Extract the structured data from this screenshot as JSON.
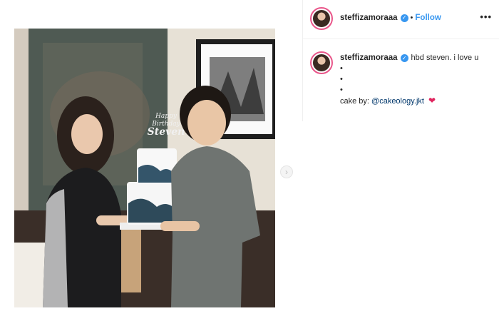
{
  "post": {
    "username": "steffizamoraaa",
    "follow_label": "Follow",
    "separator": "•",
    "more_label": "•••",
    "verified_mark": "✓",
    "photo_description_tag": "birthday-cake-photo",
    "cake_topper": [
      "Happy",
      "Birthday",
      "Steven"
    ],
    "next_icon": "chevron-right-icon"
  },
  "caption": {
    "username": "steffizamoraaa",
    "text": "hbd steven. i love u",
    "bullet_1": "•",
    "bullet_2": "•",
    "bullet_3": "•",
    "credit_prefix": "cake by:",
    "mention": "@cakeology.jkt",
    "heart": "❤"
  },
  "colors": {
    "accent": "#3897f0",
    "avatar_ring": "#e9568a",
    "heart": "#e0245e",
    "mention": "#00376b"
  }
}
